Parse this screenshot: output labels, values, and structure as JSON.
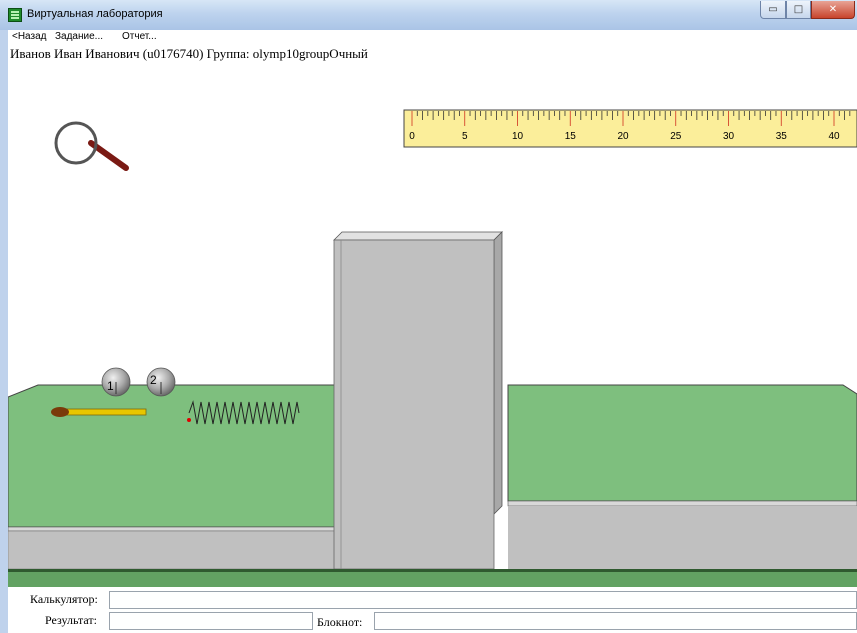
{
  "window": {
    "title": "Виртуальная лаборатория",
    "controls": {
      "minimize": "▭",
      "maximize": "□",
      "close": "✕"
    }
  },
  "menu": {
    "back": "<Назад",
    "task": "Задание...",
    "report": "Отчет..."
  },
  "user": {
    "line": "Иванов Иван Иванович (u0176740)  Группа: olymp10groupОчный"
  },
  "tools": {
    "magnifier_icon": "magnifier-icon",
    "ruler": {
      "ticks": [
        "0",
        "5",
        "10",
        "15",
        "20",
        "25",
        "30",
        "35",
        "40"
      ]
    }
  },
  "scene": {
    "balls": [
      {
        "label": "1"
      },
      {
        "label": "2"
      }
    ],
    "colors": {
      "table_top": "#7ebf7e",
      "table_side": "#c0c0c0",
      "ruler_bg": "#fbee9a",
      "floor": "#62a262"
    }
  },
  "bottom": {
    "calculator_label": "Калькулятор:",
    "calculator_value": "",
    "result_label": "Результат:",
    "result_value": "",
    "notepad_label": "Блокнот:",
    "notepad_value": ""
  }
}
